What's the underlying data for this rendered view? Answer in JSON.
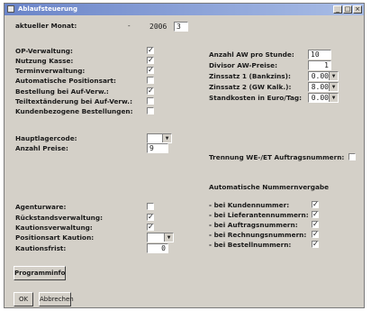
{
  "window": {
    "title": "Ablaufsteuerung",
    "controls": [
      "_",
      "□",
      "×"
    ]
  },
  "month": {
    "label": "aktueller Monat:",
    "separator": "-",
    "year": "2006",
    "month": "3"
  },
  "left": {
    "rows": [
      {
        "label": "OP-Verwaltung:",
        "checked": true
      },
      {
        "label": "Nutzung Kasse:",
        "checked": true
      },
      {
        "label": "Terminverwaltung:",
        "checked": true
      },
      {
        "label": "Automatische Positionsart:",
        "checked": false
      },
      {
        "label": "Bestellung bei Auf-Verw.:",
        "checked": true
      },
      {
        "label": "Teiltextänderung bei Auf-Verw.:",
        "checked": false
      },
      {
        "label": "Kundenbezogene Bestellungen:",
        "checked": false
      }
    ],
    "hauptlager_label": "Hauptlagercode:",
    "anzahl_preise_label": "Anzahl Preise:",
    "anzahl_preise_value": "9",
    "agenturware_label": "Agenturware:",
    "agenturware_checked": false,
    "rueckstand_label": "Rückstandsverwaltung:",
    "rueckstand_checked": true,
    "kaution_label": "Kautionsverwaltung:",
    "kaution_checked": true,
    "positionsart_label": "Positionsart Kaution:",
    "kautionsfrist_label": "Kautionsfrist:",
    "kautionsfrist_value": "0"
  },
  "right": {
    "aw_label": "Anzahl AW pro Stunde:",
    "aw_value": "10",
    "divisor_label": "Divisor AW-Preise:",
    "divisor_value": "1",
    "zins1_label": "Zinssatz 1 (Bankzins):",
    "zins1_value": "0.00",
    "zins2_label": "Zinssatz 2 (GW Kalk.):",
    "zins2_value": "8.00",
    "stand_label": "Standkosten in Euro/Tag:",
    "stand_value": "0.00",
    "trennung_label": "Trennung WE-/ET Auftragsnummern:",
    "trennung_checked": false,
    "auto_header": "Automatische Nummernvergabe",
    "auto_rows": [
      {
        "label": "- bei Kundennummer:",
        "checked": true
      },
      {
        "label": "- bei Lieferantennummern:",
        "checked": true
      },
      {
        "label": "- bei Auftragsnummern:",
        "checked": true
      },
      {
        "label": "- bei Rechnungsnummern:",
        "checked": true
      },
      {
        "label": "- bei Bestellnummern:",
        "checked": true
      }
    ]
  },
  "buttons": {
    "programminfo": "Programminfo",
    "ok": "OK",
    "abbrechen": "Abbrechen"
  }
}
